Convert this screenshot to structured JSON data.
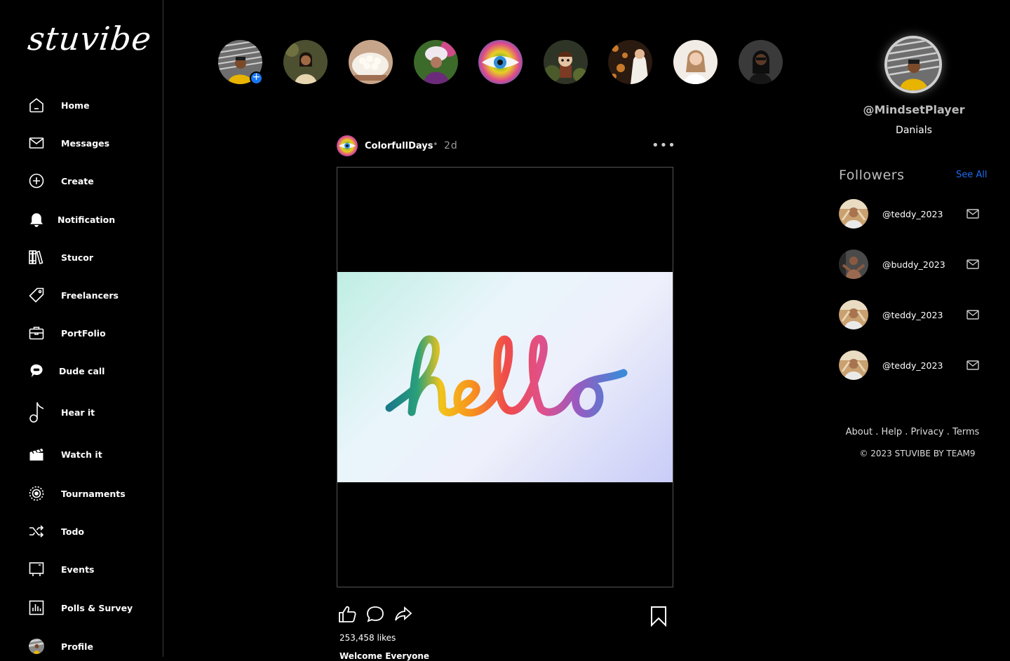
{
  "brand": {
    "logo_text": "stuvibe"
  },
  "sidebar": {
    "items": [
      {
        "label": "Home",
        "icon": "home-icon"
      },
      {
        "label": "Messages",
        "icon": "mail-icon"
      },
      {
        "label": "Create",
        "icon": "plus-circle-icon"
      },
      {
        "label": "Notification",
        "icon": "bell-icon"
      },
      {
        "label": "Stucor",
        "icon": "books-icon"
      },
      {
        "label": "Freelancers",
        "icon": "tag-icon"
      },
      {
        "label": "PortFolio",
        "icon": "briefcase-icon"
      },
      {
        "label": "Dude call",
        "icon": "chat-bubble-icon"
      },
      {
        "label": "Hear it",
        "icon": "music-note-icon"
      },
      {
        "label": "Watch it",
        "icon": "clapperboard-icon"
      },
      {
        "label": "Tournaments",
        "icon": "target-icon"
      },
      {
        "label": "Todo",
        "icon": "shuffle-icon"
      },
      {
        "label": "Events",
        "icon": "easel-icon"
      },
      {
        "label": "Polls & Survey",
        "icon": "bar-chart-icon"
      },
      {
        "label": "Profile",
        "icon": "avatar"
      }
    ]
  },
  "stories": {
    "add_label": "+"
  },
  "post": {
    "username": "ColorfullDays",
    "separator": "•",
    "time": "2d",
    "more_label": "•••",
    "image_text": "hello",
    "likes": "253,458 likes",
    "caption": "Welcome Everyone"
  },
  "profile": {
    "handle": "@MindsetPlayer",
    "name": "Danials"
  },
  "followers": {
    "title": "Followers",
    "see_all": "See All",
    "list": [
      {
        "name": "@teddy_2023"
      },
      {
        "name": "@buddy_2023"
      },
      {
        "name": "@teddy_2023"
      },
      {
        "name": "@teddy_2023"
      }
    ]
  },
  "footer": {
    "links": [
      "About",
      "Help",
      "Privacy",
      "Terms"
    ],
    "link_sep": " . ",
    "copyright": "© 2023 STUVIBE BY TEAM9"
  },
  "colors": {
    "accent": "#1877f2",
    "link": "#1d6cf0",
    "background": "#000000"
  }
}
